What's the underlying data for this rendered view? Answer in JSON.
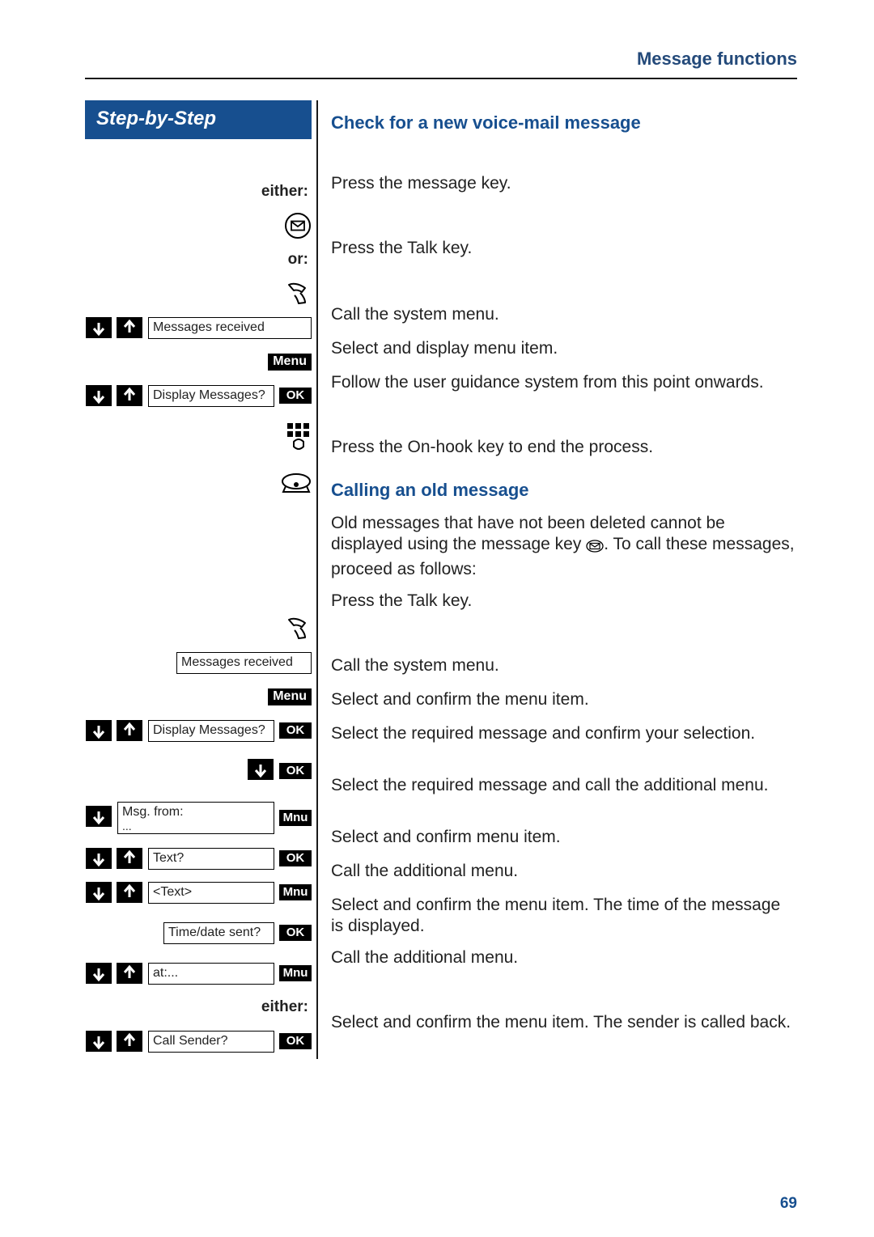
{
  "header": "Message functions",
  "step_title": "Step-by-Step",
  "page_number": "69",
  "labels": {
    "either": "either:",
    "or": "or:",
    "menu": "Menu",
    "ok": "OK",
    "mnu": "Mnu"
  },
  "sec1": {
    "title": "Check for a new voice-mail message",
    "r_msgkey": "Press the message key.",
    "r_talk": "Press the Talk key.",
    "d_msgs_received": "Messages received",
    "r_menu": "Call the system menu.",
    "d_display_msgs": "Display Messages?",
    "r_select_display": "Select and display menu item.",
    "r_follow": "Follow the user guidance system from this point onwards.",
    "r_onhook": "Press the On-hook key to end the process."
  },
  "sec2": {
    "title": "Calling an old message",
    "intro_a": "Old messages that have not been deleted cannot be displayed using the message key",
    "intro_b": ". To call these messages, proceed as follows:",
    "r_talk": "Press the Talk key.",
    "d_msgs_received": "Messages received",
    "r_menu": "Call the system menu.",
    "d_display_msgs": "Display Messages?",
    "r_select_confirm": "Select and confirm the menu item.",
    "r_select_req_conf": "Select the required message and confirm your selection.",
    "d_msg_from": "Msg. from:",
    "d_msg_from_sub": "...",
    "r_select_req_addl": "Select the required message and call the additional menu.",
    "d_text_q": "Text?",
    "r_sel_conf_item": "Select and confirm menu item.",
    "d_text": "<Text>",
    "r_call_addl": "Call the additional menu.",
    "d_time_sent": "Time/date sent?",
    "r_time_disp": "Select and confirm the menu item. The time of the message is displayed.",
    "d_at": "at:...",
    "r_call_addl2": "Call the additional menu.",
    "d_call_sender": "Call Sender?",
    "r_call_sender": "Select and confirm the menu item. The sender is called back."
  }
}
